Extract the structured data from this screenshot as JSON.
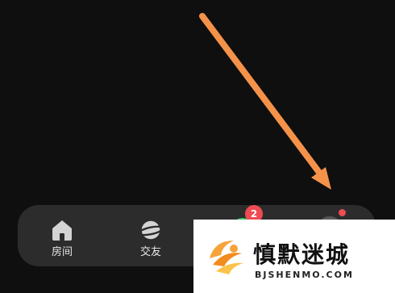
{
  "tabs": [
    {
      "label": "房间",
      "icon": "home-icon"
    },
    {
      "label": "交友",
      "icon": "planet-icon"
    },
    {
      "label": "",
      "icon": "message-icon"
    },
    {
      "label": "",
      "icon": "avatar-icon"
    }
  ],
  "badges": {
    "messages_count": "2",
    "me_dot": true
  },
  "annotation": {
    "type": "arrow",
    "color": "#f5924a",
    "points_to": "me-tab-red-dot"
  },
  "watermark": {
    "title": "慎默迷城",
    "domain": "BJSHENMO.COM",
    "logo": "swirl-logo-icon"
  },
  "colors": {
    "background": "#0f0f0f",
    "tab_bar": "#2c2c2c",
    "badge": "#ef4b52",
    "arrow": "#f5924a",
    "icon": "#d4d4d4"
  }
}
